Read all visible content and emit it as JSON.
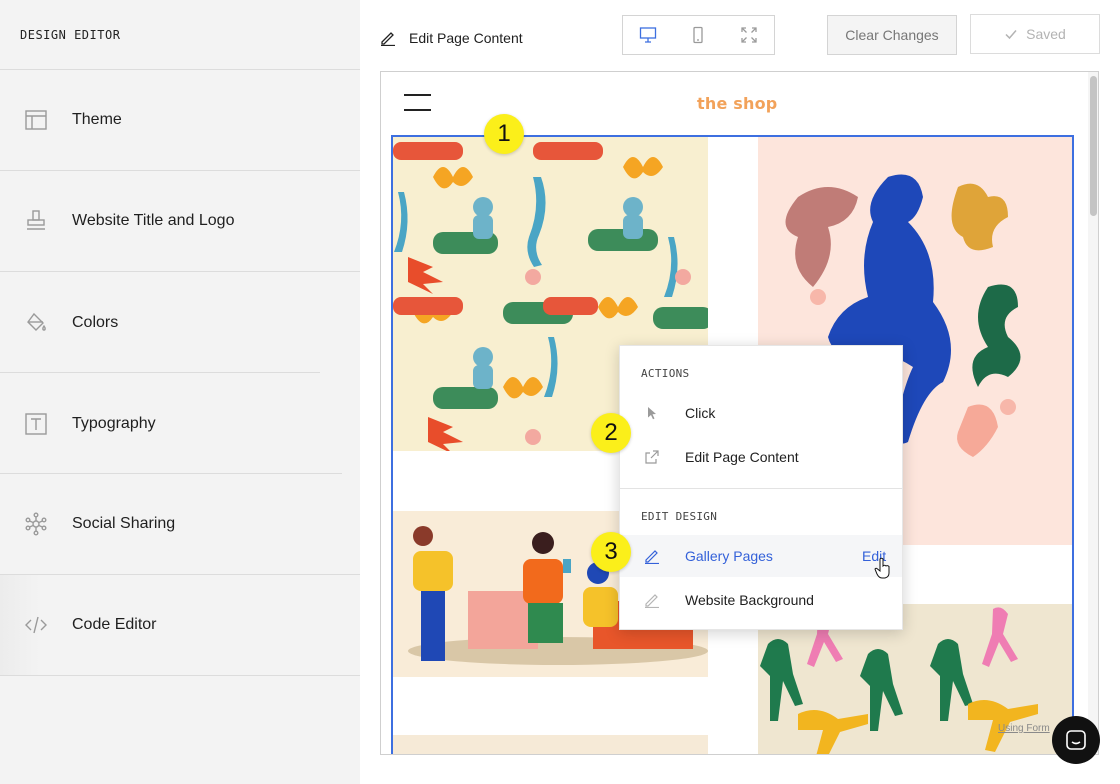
{
  "sidebar": {
    "title": "DESIGN EDITOR",
    "items": [
      {
        "label": "Theme",
        "icon": "layout-icon"
      },
      {
        "label": "Website Title and Logo",
        "icon": "stamp-icon"
      },
      {
        "label": "Colors",
        "icon": "paint-bucket-icon"
      },
      {
        "label": "Typography",
        "icon": "text-box-icon"
      },
      {
        "label": "Social Sharing",
        "icon": "network-icon"
      },
      {
        "label": "Code Editor",
        "icon": "code-icon"
      }
    ]
  },
  "topbar": {
    "title": "Edit Page Content",
    "devices": [
      "desktop-icon",
      "mobile-icon",
      "fullscreen-icon"
    ],
    "clear_label": "Clear Changes",
    "saved_label": "Saved"
  },
  "preview": {
    "logo": "the shop",
    "caption": "Using Form"
  },
  "context_menu": {
    "actions_heading": "ACTIONS",
    "actions": [
      {
        "label": "Click",
        "icon": "pointer-icon"
      },
      {
        "label": "Edit Page Content",
        "icon": "external-link-icon"
      }
    ],
    "design_heading": "EDIT DESIGN",
    "design_items": [
      {
        "label": "Gallery Pages",
        "icon": "pencil-icon",
        "action": "Edit"
      },
      {
        "label": "Website Background",
        "icon": "pencil-icon"
      }
    ]
  },
  "badges": [
    "1",
    "2",
    "3"
  ],
  "colors": {
    "accent": "#3461d9",
    "selection": "#3d6fe0",
    "badge": "#fbef1a",
    "logo": "#f2a25a"
  }
}
